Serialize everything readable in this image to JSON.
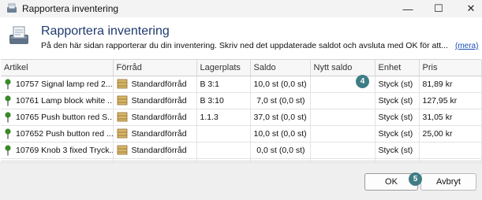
{
  "window": {
    "title": "Rapportera inventering",
    "minimize_glyph": "—",
    "maximize_glyph": "☐",
    "close_glyph": "✕"
  },
  "header": {
    "title": "Rapportera inventering",
    "description": "På den här sidan rapporterar du din inventering. Skriv ned det uppdaterade saldot och avsluta med OK för att...",
    "more_link": "(mera)"
  },
  "table": {
    "columns": [
      "Artikel",
      "Förråd",
      "Lagerplats",
      "Saldo",
      "Nytt saldo",
      "Enhet",
      "Pris"
    ],
    "rows": [
      {
        "artikel": "10757 Signal lamp red 2...",
        "forrad": "Standardförråd",
        "lagerplats": "B 3:1",
        "saldo": "10,0 st (0,0 st)",
        "nytt_saldo": "",
        "enhet": "Styck (st)",
        "pris": "81,89 kr"
      },
      {
        "artikel": "10761 Lamp block white ...",
        "forrad": "Standardförråd",
        "lagerplats": "B 3:10",
        "saldo": "7,0 st (0,0 st)",
        "nytt_saldo": "",
        "enhet": "Styck (st)",
        "pris": "127,95 kr"
      },
      {
        "artikel": "10765 Push button red S...",
        "forrad": "Standardförråd",
        "lagerplats": "1.1.3",
        "saldo": "37,0 st (0,0 st)",
        "nytt_saldo": "",
        "enhet": "Styck (st)",
        "pris": "31,05 kr"
      },
      {
        "artikel": "107652 Push button red ...",
        "forrad": "Standardförråd",
        "lagerplats": "",
        "saldo": "10,0 st (0,0 st)",
        "nytt_saldo": "",
        "enhet": "Styck (st)",
        "pris": "25,00 kr"
      },
      {
        "artikel": "10769 Knob 3 fixed Tryck...",
        "forrad": "Standardförråd",
        "lagerplats": "",
        "saldo": "0,0 st (0,0 st)",
        "nytt_saldo": "",
        "enhet": "Styck (st)",
        "pris": ""
      }
    ]
  },
  "annotations": {
    "badge_nytt_saldo": "4",
    "badge_ok": "5"
  },
  "footer": {
    "ok_label": "OK",
    "cancel_label": "Avbryt"
  },
  "colors": {
    "badge": "#3f7d86",
    "header_title": "#1f3b6e",
    "link": "#1a4fb5",
    "pin_green": "#3a8a2a"
  },
  "icons": {
    "app": "report-inventory-icon",
    "article": "green-pin-icon",
    "store": "storage-shelf-icon"
  }
}
